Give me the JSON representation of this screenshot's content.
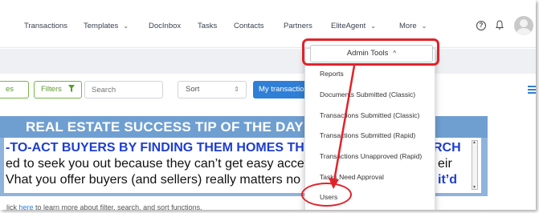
{
  "nav": {
    "items": [
      {
        "label": "Transactions",
        "chevron": false
      },
      {
        "label": "Templates",
        "chevron": true
      },
      {
        "label": "DocInbox",
        "chevron": false
      },
      {
        "label": "Tasks",
        "chevron": false
      },
      {
        "label": "Contacts",
        "chevron": false
      },
      {
        "label": "Partners",
        "chevron": false
      },
      {
        "label": "EliteAgent",
        "chevron": true
      },
      {
        "label": "More",
        "chevron": true
      }
    ],
    "help_icon": "question-circle-icon",
    "bell_icon": "bell-icon",
    "avatar_icon": "user-avatar"
  },
  "toolbar": {
    "first_button_label": "es",
    "filters_label": "Filters",
    "filter_icon": "funnel-icon",
    "search_placeholder": "Search",
    "sort_label": "Sort",
    "sort_arrows": "⇕",
    "my_transactions_label": "My transactio",
    "list_view_icon": "list-view-icon"
  },
  "banner": {
    "title": "REAL ESTATE SUCCESS TIP OF THE DAY",
    "line1": "-TO-ACT BUYERS BY FINDING THEM HOMES THE",
    "line1_end": "RCH",
    "line2": "ed to seek you out because they can’t get easy acces",
    "line2_end": "eir",
    "line3": "Vhat you offer buyers (and sellers) really matters no m",
    "line3_end": "it’d"
  },
  "help_text": {
    "prefix": "lick ",
    "link": "here",
    "suffix": " to learn more about filter, search, and sort functions."
  },
  "admin_menu": {
    "button_label": "Admin Tools",
    "items": [
      "Reports",
      "Documents Submitted (Classic)",
      "Transactions Submitted (Classic)",
      "Transactions Submitted (Rapid)",
      "Transactions Unapproved (Rapid)",
      "Tasks Need Approval",
      "Users"
    ]
  },
  "colors": {
    "annotation_red": "#e2222a",
    "accent_blue": "#2f7fd6",
    "filter_green": "#5c9a2c"
  }
}
